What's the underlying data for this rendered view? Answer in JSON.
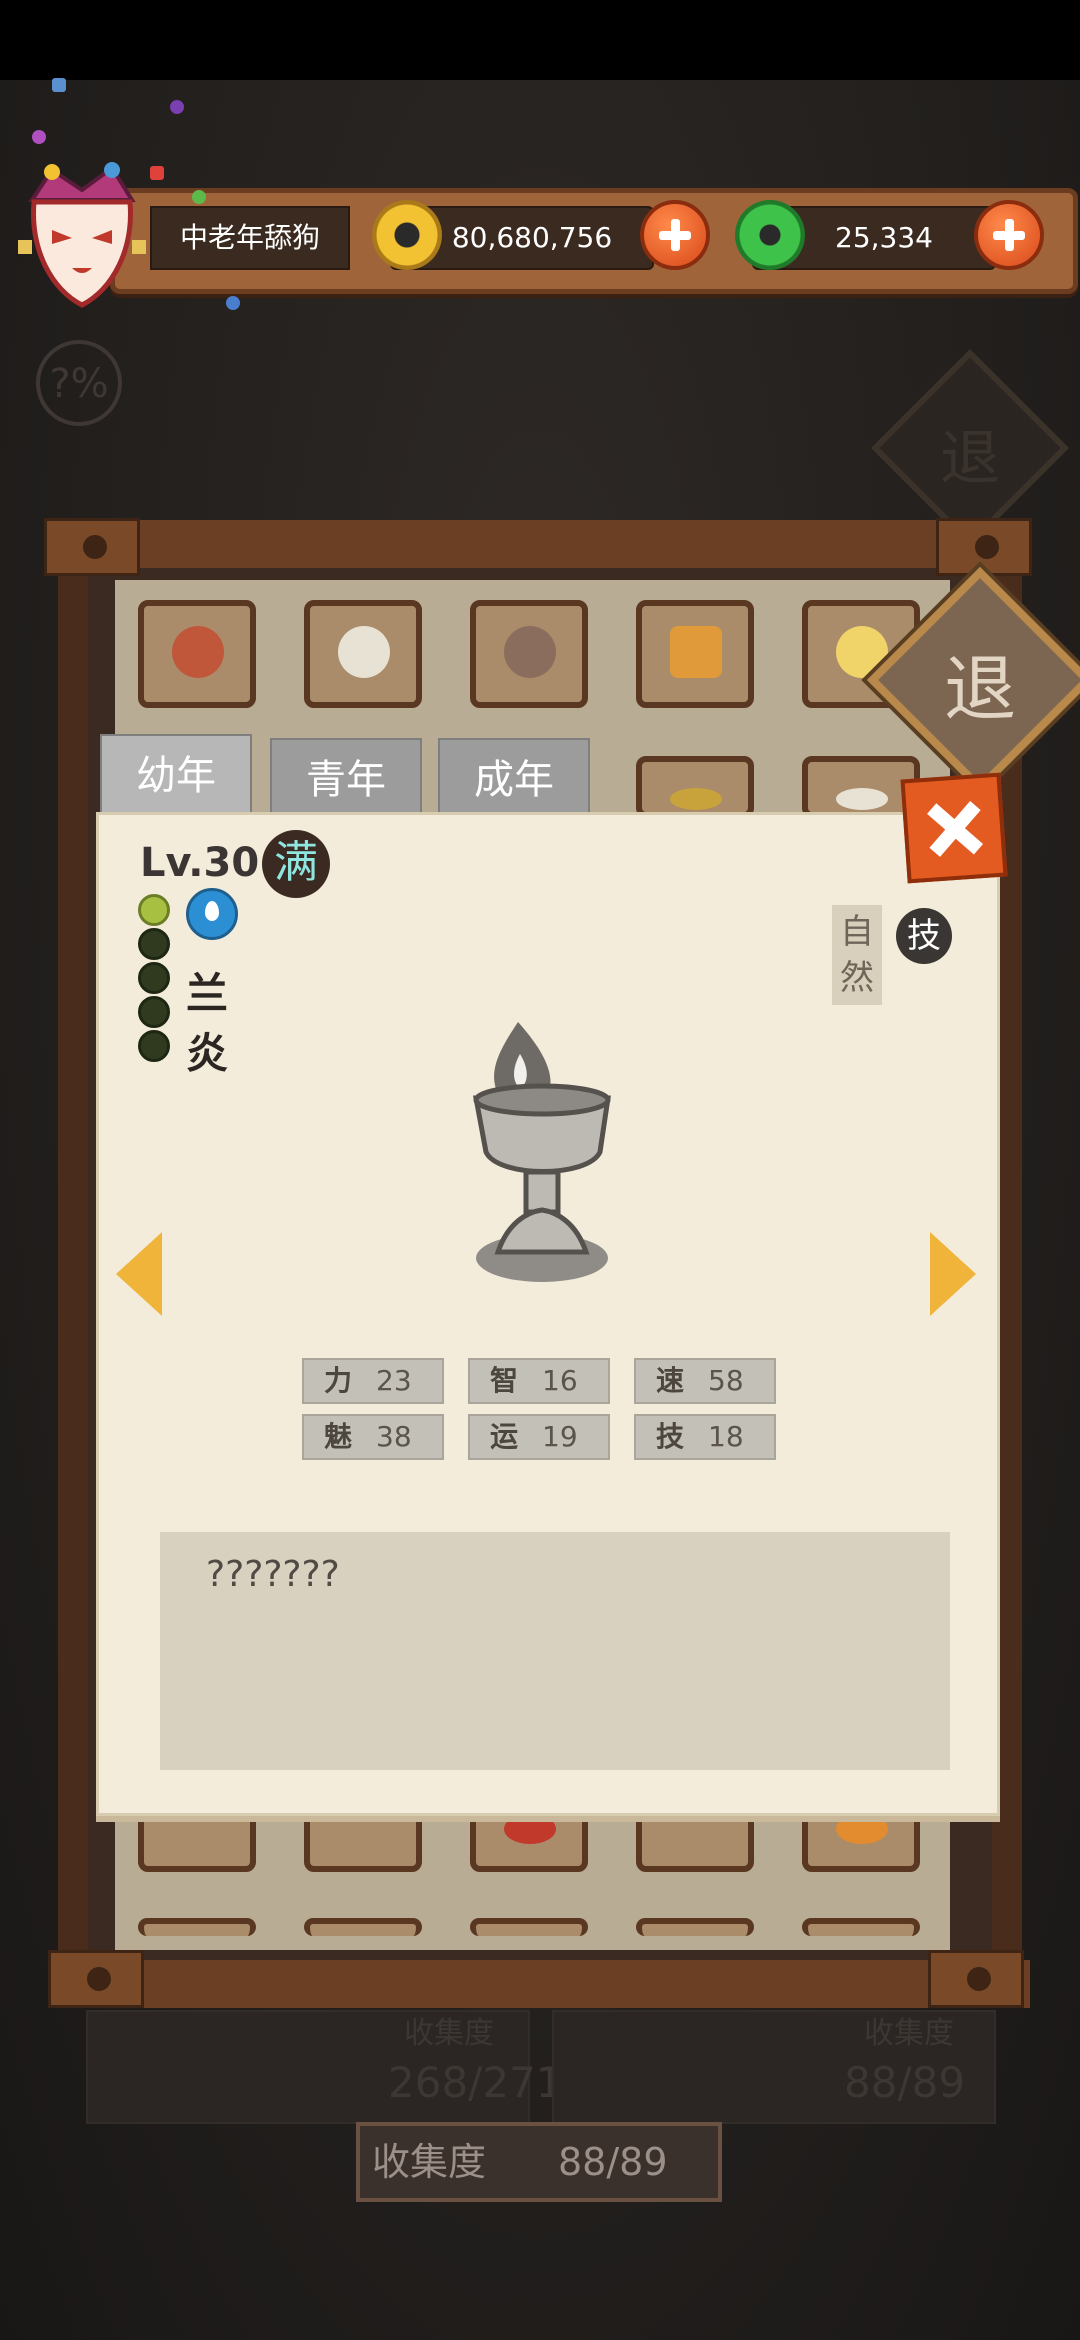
{
  "player": {
    "name": "中老年舔狗"
  },
  "resources": {
    "coins": "80,680,756",
    "gems": "25,334"
  },
  "side": {
    "retreat_label": "退",
    "percent_label": "?%"
  },
  "tabs": [
    {
      "label": "幼年",
      "active": true
    },
    {
      "label": "青年",
      "active": false
    },
    {
      "label": "成年",
      "active": false
    }
  ],
  "pet": {
    "level": "Lv.30",
    "full_badge": "满",
    "name_chars": [
      "兰",
      "炎"
    ],
    "nature": "自然",
    "skill_badge": "技",
    "growth_total": 5,
    "growth_lit": 1,
    "stats": [
      {
        "key": "力",
        "value": "23"
      },
      {
        "key": "智",
        "value": "16"
      },
      {
        "key": "速",
        "value": "58"
      },
      {
        "key": "魅",
        "value": "38"
      },
      {
        "key": "运",
        "value": "19"
      },
      {
        "key": "技",
        "value": "18"
      }
    ],
    "description": "???????"
  },
  "collection": {
    "label": "收集度",
    "value": "88/89",
    "bg_left_label": "收集度",
    "bg_left_value": "268/271",
    "bg_right_label": "收集度",
    "bg_right_value": "88/89"
  },
  "colors": {
    "accent_orange": "#e45b22",
    "coin_gold": "#f2c232",
    "gem_green": "#3fc24a"
  }
}
